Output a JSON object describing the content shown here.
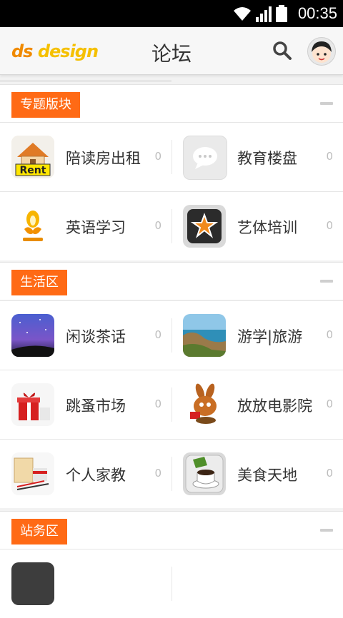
{
  "status_bar": {
    "time": "00:35"
  },
  "app_bar": {
    "logo_part1": "ds",
    "logo_part2": "design",
    "title": "论坛"
  },
  "sections": [
    {
      "title": "专题版块",
      "items": [
        {
          "name": "陪读房出租",
          "count": "0",
          "icon": "rent-house-icon"
        },
        {
          "name": "教育楼盘",
          "count": "0",
          "icon": "chat-bubble-icon"
        },
        {
          "name": "英语学习",
          "count": "0",
          "icon": "lamp-logo-icon"
        },
        {
          "name": "艺体培训",
          "count": "0",
          "icon": "star-pencil-icon"
        }
      ]
    },
    {
      "title": "生活区",
      "items": [
        {
          "name": "闲谈茶话",
          "count": "0",
          "icon": "starry-sky-icon"
        },
        {
          "name": "游学|旅游",
          "count": "0",
          "icon": "coast-landscape-icon"
        },
        {
          "name": "跳蚤市场",
          "count": "0",
          "icon": "gift-box-icon"
        },
        {
          "name": "放放电影院",
          "count": "0",
          "icon": "rabbit-cartoon-icon"
        },
        {
          "name": "个人家教",
          "count": "0",
          "icon": "paper-pens-icon"
        },
        {
          "name": "美食天地",
          "count": "0",
          "icon": "coffee-cup-icon"
        }
      ]
    },
    {
      "title": "站务区",
      "items": []
    }
  ],
  "colors": {
    "accent": "#ff6a15"
  }
}
